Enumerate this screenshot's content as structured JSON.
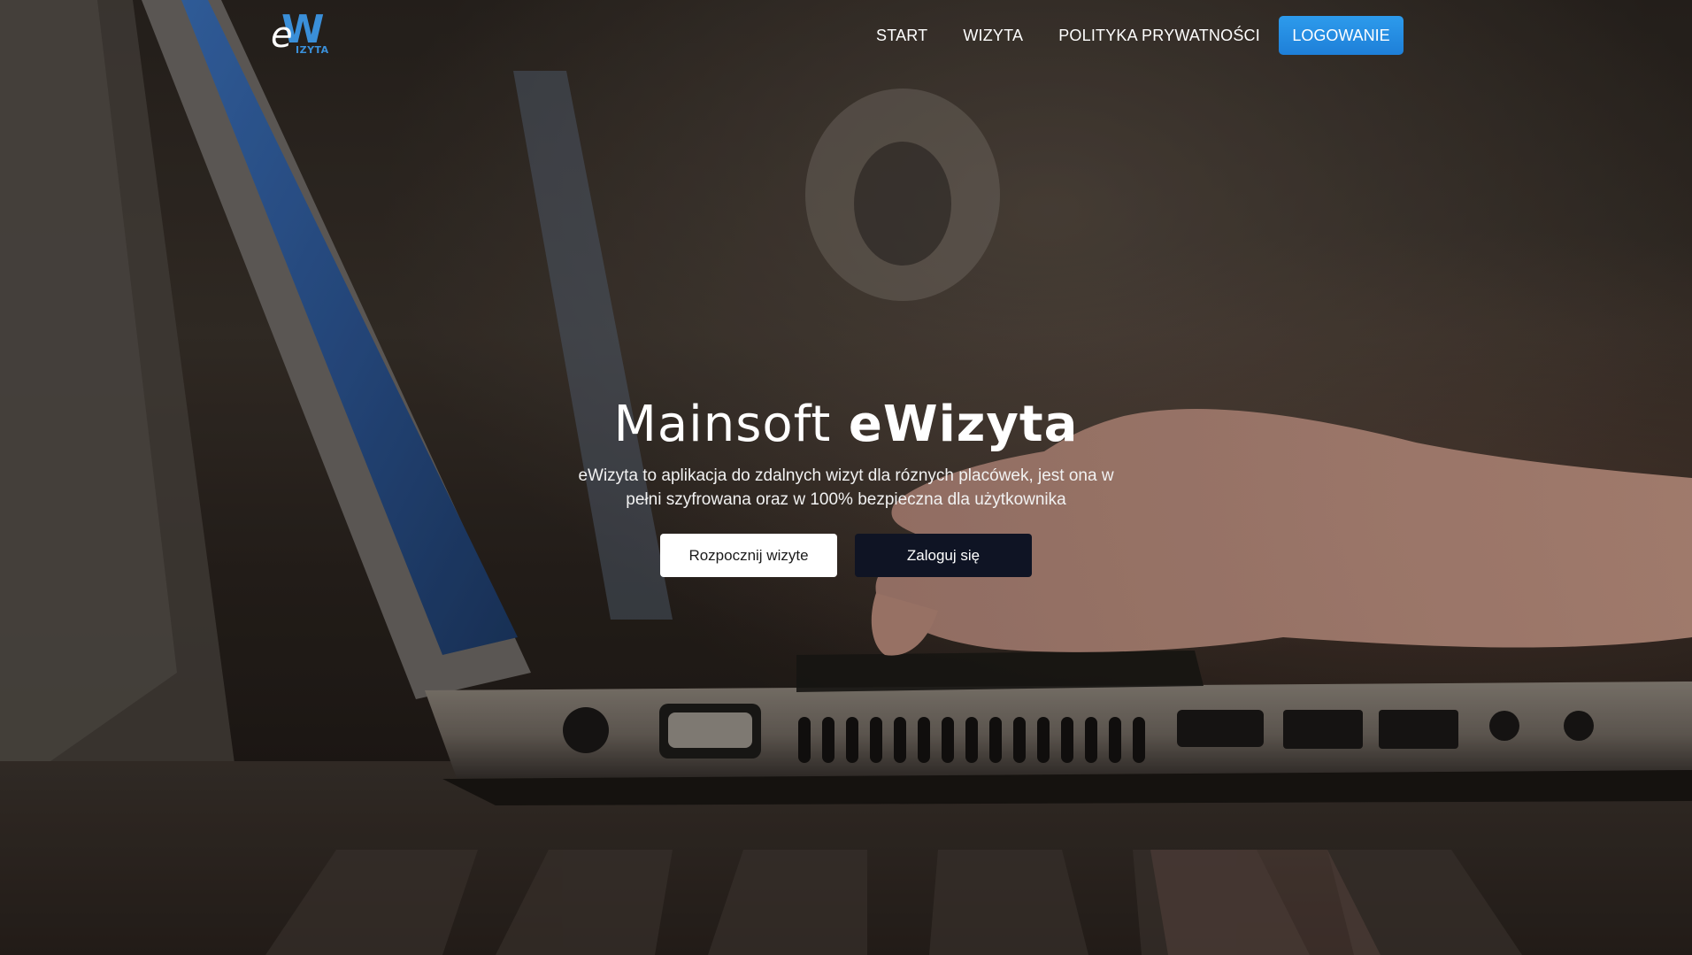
{
  "logo": {
    "letter_e": "e",
    "letter_w": "W",
    "subtitle": "IZYTA",
    "accent_color": "#3a8fd9"
  },
  "nav": {
    "links": [
      {
        "label": "START"
      },
      {
        "label": "WIZYTA"
      },
      {
        "label": "POLITYKA PRYWATNOŚCI"
      }
    ],
    "login_label": "LOGOWANIE",
    "login_color": "#2d9bec"
  },
  "hero": {
    "title_prefix": "Mainsoft",
    "title_brand": "eWizyta",
    "description": "eWizyta to aplikacja do zdalnych wizyt dla róznych placówek, jest ona w pełni szyfrowana oraz w 100% bezpieczna dla użytkownika",
    "primary_button": "Rozpocznij wizyte",
    "secondary_button": "Zaloguj się",
    "secondary_color": "#0f1424"
  }
}
